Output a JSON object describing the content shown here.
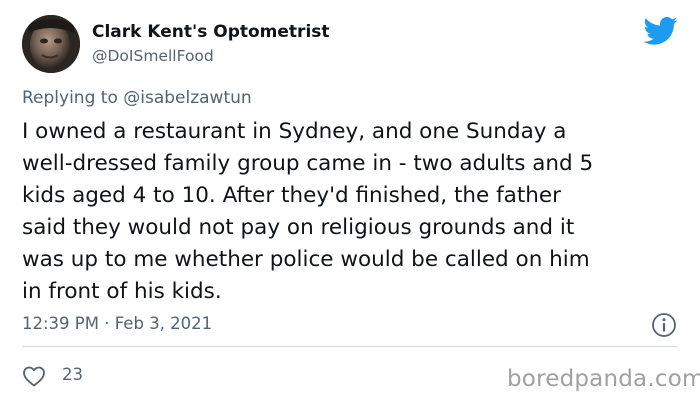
{
  "author": {
    "name": "Clark Kent's Optometrist",
    "handle": "@DoISmellFood"
  },
  "reply": {
    "prefix": "Replying to ",
    "mention": "@isabelzawtun"
  },
  "tweet": {
    "text": "I owned a restaurant in Sydney, and one Sunday a\nwell-dressed family group came in - two adults and 5\nkids aged 4 to 10.  After they'd finished, the father\nsaid they would not pay on religious grounds and it\nwas up to me whether police would be called on him\nin front of his kids.",
    "timestamp": "12:39 PM · Feb 3, 2021"
  },
  "engagement": {
    "likes": "23"
  },
  "watermark": "boredpanda.com",
  "colors": {
    "twitter_blue": "#1d9bf0",
    "secondary_text": "#536471",
    "divider": "#cfd9de"
  },
  "icons": {
    "logo": "twitter-bird-icon",
    "info": "info-icon",
    "like": "heart-icon"
  }
}
